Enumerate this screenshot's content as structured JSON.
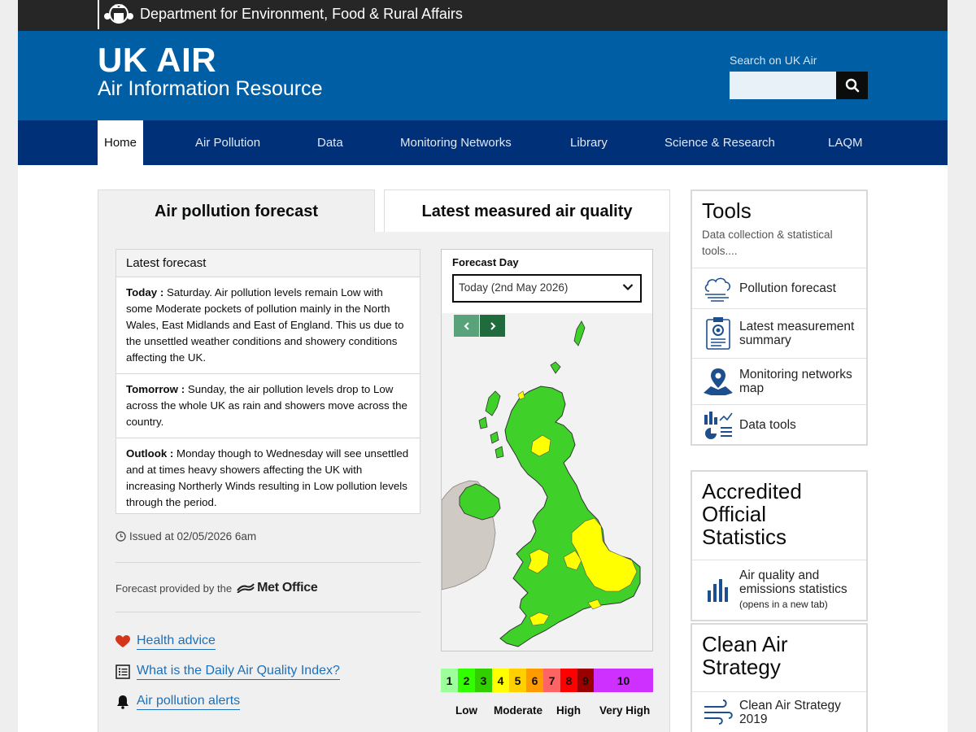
{
  "gov": {
    "department": "Department for Environment, Food & Rural Affairs"
  },
  "brand": {
    "title": "UK AIR",
    "subtitle": "Air Information Resource"
  },
  "search": {
    "label": "Search on UK Air",
    "value": "",
    "placeholder": ""
  },
  "nav": {
    "items": [
      {
        "label": "Home",
        "active": true
      },
      {
        "label": "Air Pollution"
      },
      {
        "label": "Data"
      },
      {
        "label": "Monitoring Networks"
      },
      {
        "label": "Library"
      },
      {
        "label": "Science & Research"
      },
      {
        "label": "LAQM"
      }
    ]
  },
  "tabs": {
    "forecast": "Air pollution forecast",
    "measured": "Latest measured air quality"
  },
  "forecast": {
    "heading": "Latest forecast",
    "entries": [
      {
        "label": "Today :",
        "text": " Saturday. Air pollution levels remain Low with some Moderate pockets of pollution mainly in the North Wales, East Midlands and East of England. This us due to the unsettled weather conditions and showery conditions affecting the UK."
      },
      {
        "label": "Tomorrow :",
        "text": " Sunday, the air pollution levels drop to Low across the whole UK as rain and showers move across the country."
      },
      {
        "label": "Outlook :",
        "text": " Monday though to Wednesday will see unsettled and at times heavy showers affecting the UK with increasing Northerly Winds resulting in Low pollution levels through the period."
      }
    ],
    "issued": "Issued at 02/05/2026 6am",
    "provided_by": "Forecast provided by the",
    "provider": "Met Office"
  },
  "links": [
    {
      "label": "Health advice",
      "icon": "heart-icon"
    },
    {
      "label": "What is the Daily Air Quality Index?",
      "icon": "list-icon"
    },
    {
      "label": "Air pollution alerts",
      "icon": "bell-icon"
    }
  ],
  "map": {
    "forecast_day_label": "Forecast Day",
    "selected_day": "Today (2nd May 2026)",
    "low_color": "#3fd12a",
    "moderate_color": "#ffff00",
    "land_color": "#cfcbc4",
    "sea_color": "#f2f2f2"
  },
  "legend": {
    "bands": [
      {
        "value": "1",
        "color": "#9cff9c"
      },
      {
        "value": "2",
        "color": "#31ff00"
      },
      {
        "value": "3",
        "color": "#31cf00"
      },
      {
        "value": "4",
        "color": "#ffff00"
      },
      {
        "value": "5",
        "color": "#ffcf00"
      },
      {
        "value": "6",
        "color": "#ff9a00"
      },
      {
        "value": "7",
        "color": "#ff6464"
      },
      {
        "value": "8",
        "color": "#ff0000"
      },
      {
        "value": "9",
        "color": "#990000"
      },
      {
        "value": "10",
        "color": "#ce30ff"
      }
    ],
    "labels": [
      "Low",
      "Moderate",
      "High",
      "Very High"
    ]
  },
  "tools": {
    "title": "Tools",
    "description": "Data collection & statistical tools....",
    "items": [
      {
        "label": "Pollution forecast",
        "icon": "cloud-wind-icon"
      },
      {
        "label": "Latest measurement summary",
        "icon": "clipboard-icon"
      },
      {
        "label": "Monitoring networks map",
        "icon": "map-pin-icon"
      },
      {
        "label": "Data tools",
        "icon": "chart-tools-icon"
      }
    ]
  },
  "accredited": {
    "title": "Accredited Official Statistics",
    "item_label": "Air quality and emissions statistics",
    "item_note": "(opens in a new tab)",
    "icon": "bar-chart-icon"
  },
  "clean_air": {
    "title": "Clean Air Strategy",
    "item_label": "Clean Air Strategy 2019",
    "icon": "wind-icon"
  },
  "colors": {
    "brand_blue": "#005ea5",
    "nav_blue": "#003078",
    "link_blue": "#1d70b8",
    "gov_black": "#262626"
  }
}
